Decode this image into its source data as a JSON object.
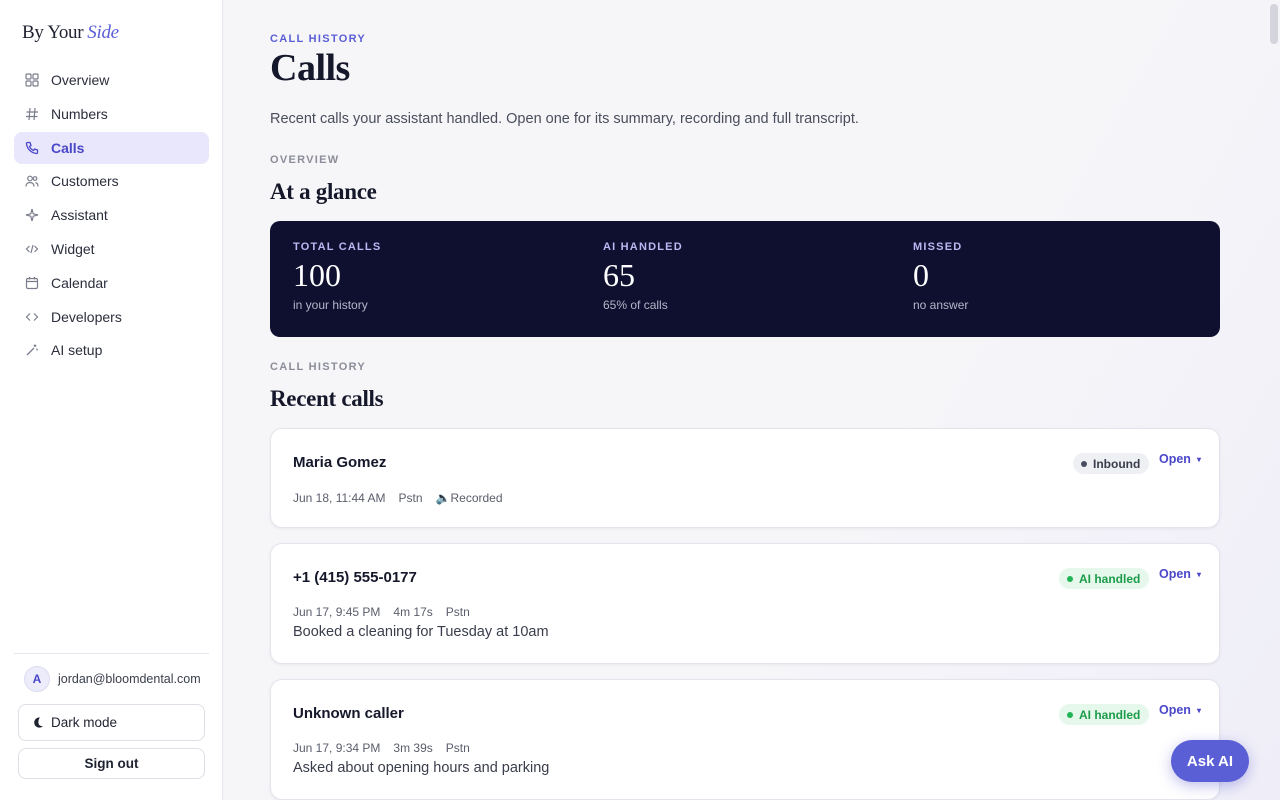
{
  "brand": {
    "name": "By Your",
    "accent": "Side"
  },
  "sidebar": {
    "items": [
      {
        "label": "Overview",
        "icon": "grid-icon"
      },
      {
        "label": "Numbers",
        "icon": "hash-icon"
      },
      {
        "label": "Calls",
        "icon": "phone-icon",
        "active": true
      },
      {
        "label": "Customers",
        "icon": "users-icon"
      },
      {
        "label": "Assistant",
        "icon": "sparkle-icon"
      },
      {
        "label": "Widget",
        "icon": "code-icon"
      },
      {
        "label": "Calendar",
        "icon": "calendar-icon"
      },
      {
        "label": "Developers",
        "icon": "brackets-icon"
      },
      {
        "label": "AI setup",
        "icon": "wand-icon"
      }
    ],
    "user": {
      "initial": "A",
      "email": "jordan@bloomdental.com"
    },
    "dark_mode_label": "Dark mode",
    "sign_out_label": "Sign out"
  },
  "page": {
    "eyebrow": "CALL HISTORY",
    "title": "Calls",
    "lead": "Recent calls your assistant handled. Open one for its summary, recording and full transcript."
  },
  "overview": {
    "eyebrow": "OVERVIEW",
    "title": "At a glance",
    "stats": [
      {
        "label": "TOTAL CALLS",
        "value": "100",
        "sub": "in your history"
      },
      {
        "label": "AI HANDLED",
        "value": "65",
        "sub": "65% of calls"
      },
      {
        "label": "MISSED",
        "value": "0",
        "sub": "no answer"
      }
    ]
  },
  "history": {
    "eyebrow": "CALL HISTORY",
    "title": "Recent calls",
    "open_label": "Open",
    "calls": [
      {
        "name": "Maria Gomez",
        "badge": "Inbound",
        "badge_type": "inbound",
        "meta": [
          "Jun 18, 11:44 AM",
          "Pstn",
          "🔈Recorded"
        ],
        "summary": ""
      },
      {
        "name": "+1 (415) 555-0177",
        "badge": "AI handled",
        "badge_type": "ai",
        "meta": [
          "Jun 17, 9:45 PM",
          "4m 17s",
          "Pstn"
        ],
        "summary": "Booked a cleaning for Tuesday at 10am"
      },
      {
        "name": "Unknown caller",
        "badge": "AI handled",
        "badge_type": "ai",
        "meta": [
          "Jun 17, 9:34 PM",
          "3m 39s",
          "Pstn"
        ],
        "summary": "Asked about opening hours and parking"
      }
    ]
  },
  "ask_ai_label": "Ask AI",
  "colors": {
    "accent": "#5b5fd6",
    "stats_bg": "#0f1030",
    "ai_green": "#1c9c4a"
  }
}
